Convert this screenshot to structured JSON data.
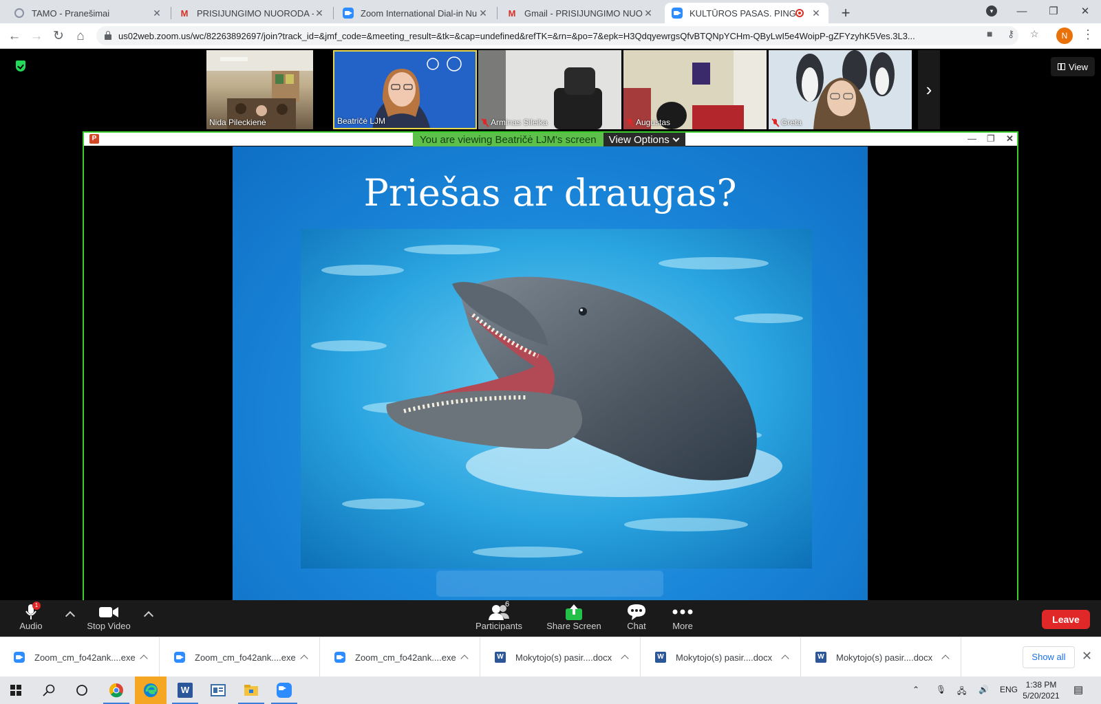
{
  "browser": {
    "tabs": [
      {
        "title": "TAMO - Pranešimai",
        "icon": "tamo-icon"
      },
      {
        "title": "PRISIJUNGIMO NUORODA - npilec",
        "icon": "gmail-icon"
      },
      {
        "title": "Zoom International Dial-in Numb",
        "icon": "zoom-icon"
      },
      {
        "title": "Gmail - PRISIJUNGIMO NUORODA",
        "icon": "gmail-icon"
      },
      {
        "title": "KULTŪROS PASAS. PINGVINAI",
        "icon": "zoom-icon",
        "active": true,
        "recording": true
      }
    ],
    "url": "us02web.zoom.us/wc/82263892697/join?track_id=&jmf_code=&meeting_result=&tk=&cap=undefined&refTK=&rn=&po=7&epk=H3QdqyewrgsQfvBTQNpYCHm-QByLwI5e4WoipP-gZFYzyhK5Ves.3L3...",
    "profile_initial": "N"
  },
  "zoom": {
    "view_label": "View",
    "participants": [
      {
        "name": "Nida Pileckienė",
        "muted": false
      },
      {
        "name": "Beatričė LJM",
        "muted": false,
        "active_speaker": true
      },
      {
        "name": "Arminas Sileika",
        "muted": true
      },
      {
        "name": "Augustas",
        "muted": true
      },
      {
        "name": "Greta",
        "muted": true
      }
    ],
    "viewing_banner": "You are viewing Beatričė LJM's screen",
    "view_options_label": "View Options",
    "slide": {
      "title": "Priešas ar draugas?"
    },
    "controls": {
      "audio_label": "Audio",
      "audio_badge": "1",
      "video_label": "Stop Video",
      "participants_label": "Participants",
      "participants_count": "6",
      "share_label": "Share Screen",
      "chat_label": "Chat",
      "more_label": "More",
      "leave_label": "Leave"
    }
  },
  "downloads": {
    "items": [
      {
        "name": "Zoom_cm_fo42ank....exe",
        "icon": "zoom-icon"
      },
      {
        "name": "Zoom_cm_fo42ank....exe",
        "icon": "zoom-icon"
      },
      {
        "name": "Zoom_cm_fo42ank....exe",
        "icon": "zoom-icon"
      },
      {
        "name": "Mokytojo(s) pasir....docx",
        "icon": "word-icon"
      },
      {
        "name": "Mokytojo(s) pasir....docx",
        "icon": "word-icon"
      },
      {
        "name": "Mokytojo(s) pasir....docx",
        "icon": "word-icon"
      }
    ],
    "show_all_label": "Show all"
  },
  "taskbar": {
    "language": "ENG",
    "time": "1:38 PM",
    "date": "5/20/2021"
  },
  "colors": {
    "zoom_blue": "#2d8cff",
    "share_border": "#3bd12d",
    "leave_red": "#e02828",
    "slide_blue": "#1a86d9"
  }
}
